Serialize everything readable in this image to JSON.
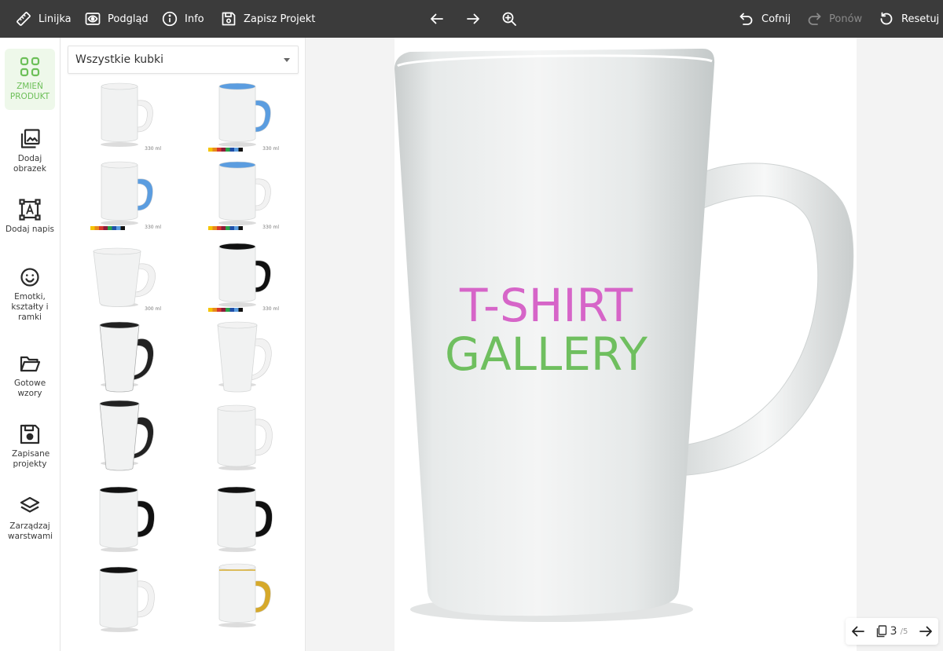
{
  "toolbar": {
    "ruler_label": "Linijka",
    "preview_label": "Podgląd",
    "info_label": "Info",
    "save_label": "Zapisz Projekt",
    "undo_label": "Cofnij",
    "redo_label": "Ponów",
    "reset_label": "Resetuj"
  },
  "sidebar": {
    "items": [
      {
        "label": "ZMIEŃ PRODUKT",
        "icon": "grid-icon",
        "active": true
      },
      {
        "label": "Dodaj obrazek",
        "icon": "image-icon"
      },
      {
        "label": "Dodaj napis",
        "icon": "text-icon"
      },
      {
        "label": "Emotki, kształty i ramki",
        "icon": "smiley-icon"
      },
      {
        "label": "Gotowe wzory",
        "icon": "folder-icon"
      },
      {
        "label": "Zapisane projekty",
        "icon": "floppy-icon"
      },
      {
        "label": "Zarządzaj warstwami",
        "icon": "layers-icon"
      }
    ]
  },
  "products": {
    "category_selected": "Wszystkie kubki",
    "items": [
      {
        "type": "classic",
        "inner": "#f2f2f2",
        "handle": "#f2f2f2",
        "capacity": "330 ml",
        "palette": false
      },
      {
        "type": "classic",
        "inner": "#5b9de0",
        "handle": "#5b9de0",
        "capacity": "330 ml",
        "palette": true
      },
      {
        "type": "classic",
        "inner": "#f2f2f2",
        "handle": "#5b9de0",
        "capacity": "330 ml",
        "palette": true
      },
      {
        "type": "classic",
        "inner": "#5b9de0",
        "handle": "#f2f2f2",
        "capacity": "330 ml",
        "palette": true
      },
      {
        "type": "latte-small",
        "inner": "#f2f2f2",
        "handle": "#f2f2f2",
        "capacity": "300 ml",
        "palette": false
      },
      {
        "type": "classic",
        "inner": "#111111",
        "handle": "#111111",
        "capacity": "330 ml",
        "palette": true
      },
      {
        "type": "latte-magic",
        "inner": "#222222",
        "handle": "#222222",
        "capacity": "",
        "palette": false
      },
      {
        "type": "latte-tall",
        "inner": "#f2f2f2",
        "handle": "#f2f2f2",
        "capacity": "",
        "palette": false
      },
      {
        "type": "latte-tall-magic",
        "inner": "#222222",
        "handle": "#222222",
        "capacity": "",
        "palette": false
      },
      {
        "type": "big",
        "inner": "#f2f2f2",
        "handle": "#f2f2f2",
        "capacity": "",
        "palette": false
      },
      {
        "type": "big",
        "inner": "#111111",
        "handle": "#111111",
        "capacity": "",
        "palette": false
      },
      {
        "type": "big",
        "inner": "#111111",
        "handle": "#111111",
        "capacity": "",
        "palette": false
      },
      {
        "type": "big",
        "inner": "#111111",
        "handle": "#f2f2f2",
        "capacity": "",
        "palette": false
      },
      {
        "type": "gold",
        "inner": "#f2f2f2",
        "handle": "#d6a92a",
        "capacity": "",
        "palette": false
      }
    ],
    "palette_colors": [
      "#f5c400",
      "#e8891c",
      "#d63a2e",
      "#8b1d3b",
      "#2aa34a",
      "#1f4fa8",
      "#5b9de0",
      "#111111"
    ]
  },
  "canvas": {
    "design_line1": "T-SHIRT",
    "design_line2": "GALLERY",
    "line1_color": "#d665c8",
    "line2_color": "#6fbf5f"
  },
  "pager": {
    "current": "3",
    "total": "/5"
  },
  "colors": {
    "topbar": "#3b3b3b",
    "accent": "#6cbf58"
  }
}
